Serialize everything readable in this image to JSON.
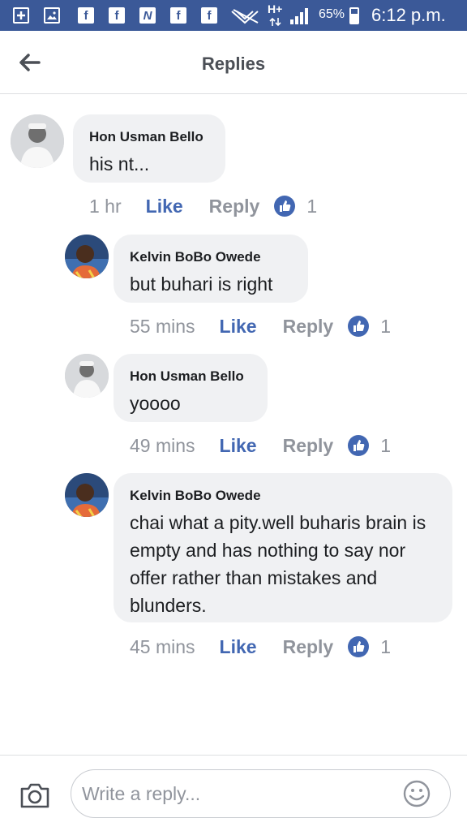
{
  "status_bar": {
    "network": "H+",
    "battery": "65%",
    "time": "6:12 p.m.",
    "accent_color": "#3b5998"
  },
  "header": {
    "title": "Replies",
    "back_icon": "arrow-left-icon"
  },
  "comments": [
    {
      "author": "Hon Usman Bello",
      "text": "his nt...",
      "time": "1 hr",
      "like_label": "Like",
      "reply_label": "Reply",
      "reaction_count": "1"
    },
    {
      "author": "Kelvin BoBo Owede",
      "text": "but buhari is right",
      "time": "55 mins",
      "like_label": "Like",
      "reply_label": "Reply",
      "reaction_count": "1"
    },
    {
      "author": "Hon Usman Bello",
      "text": "yoooo",
      "time": "49 mins",
      "like_label": "Like",
      "reply_label": "Reply",
      "reaction_count": "1"
    },
    {
      "author": "Kelvin BoBo Owede",
      "text": "chai what a pity.well buharis brain is empty and has nothing to say nor offer rather than mistakes and blunders.",
      "time": "45 mins",
      "like_label": "Like",
      "reply_label": "Reply",
      "reaction_count": "1"
    }
  ],
  "composer": {
    "placeholder": "Write a reply...",
    "camera_icon": "camera-icon",
    "emoji_icon": "smiley-icon"
  },
  "colors": {
    "like_blue": "#4267b2",
    "meta_gray": "#90949c",
    "bubble_bg": "#f0f1f3"
  }
}
